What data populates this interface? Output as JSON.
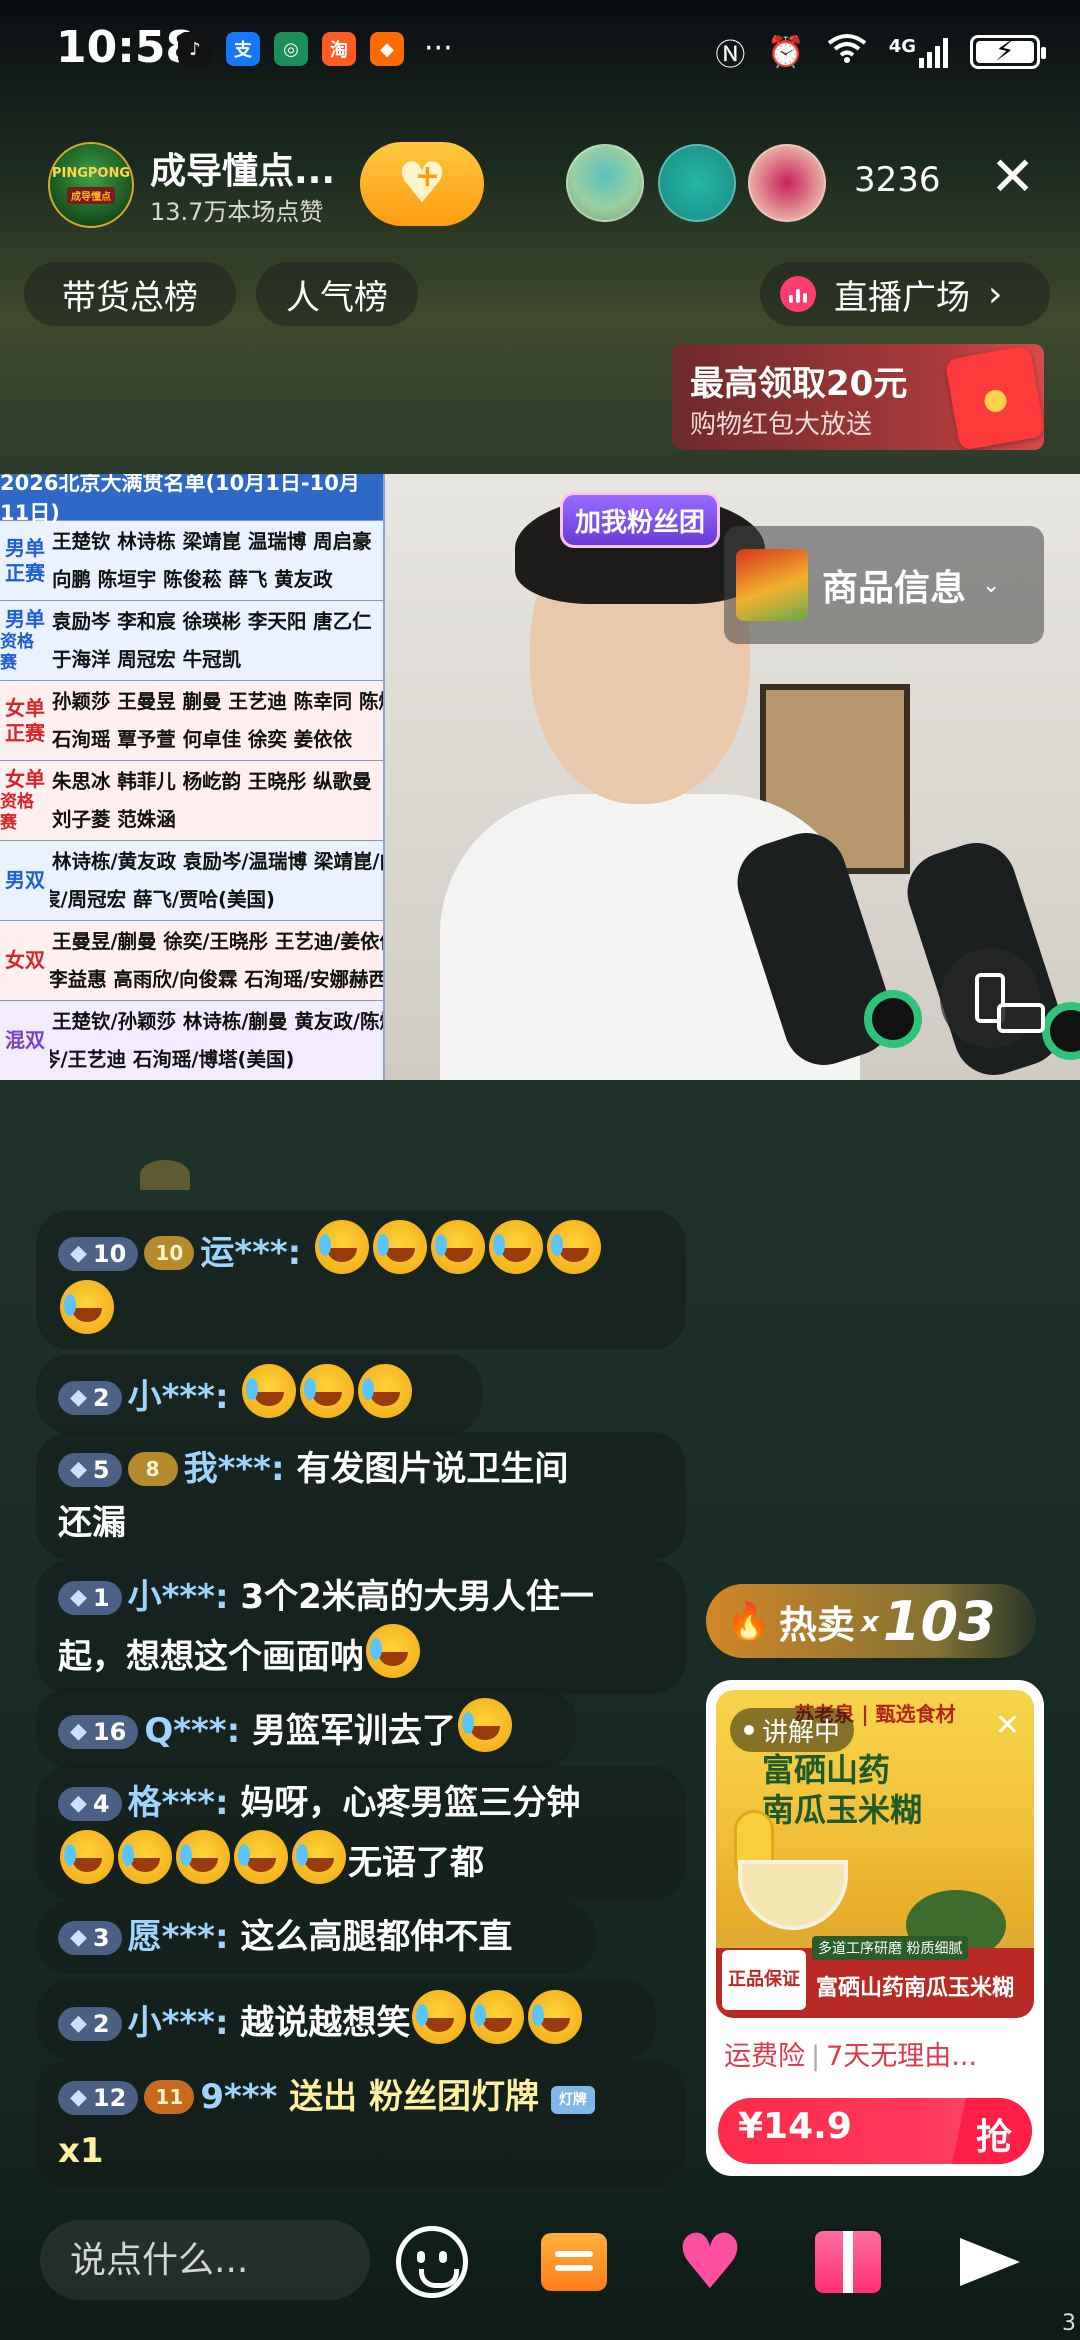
{
  "status_bar": {
    "time": "10:58",
    "apps": [
      {
        "icon": "tiktok-icon",
        "glyph": "♪",
        "color": "#111111"
      },
      {
        "icon": "alipay-icon",
        "glyph": "支",
        "color": "#1677ff"
      },
      {
        "icon": "bank-icon",
        "glyph": "◎",
        "color": "#1b8f5a"
      },
      {
        "icon": "taobao-icon",
        "glyph": "淘",
        "color": "#ff5a1f"
      },
      {
        "icon": "shop-icon",
        "glyph": "◆",
        "color": "#ff6a00"
      }
    ],
    "more": "···",
    "network": "4G"
  },
  "header": {
    "host_name": "成导懂点...",
    "host_likes": "13.7万本场点赞",
    "avatar_text": "PINGPONG",
    "avatar_sub": "成导懂点",
    "viewer_count": "3236"
  },
  "chips": {
    "sales_rank": "带货总榜",
    "popularity_rank": "人气榜",
    "live_plaza": "直播广场"
  },
  "red_packet": {
    "title": "最高领取20元",
    "subtitle": "购物红包大放送"
  },
  "video": {
    "fan_badge": "加我粉丝团",
    "product_info": "商品信息"
  },
  "schedule": {
    "title": "2026北京大满贯名单(10月1日-10月11日)",
    "rows": [
      {
        "cat1": "男单",
        "cat2": "正赛",
        "color": "#1f5fd1",
        "bg": "#eaf2ff",
        "line1": "王楚钦 林诗栋 梁靖崑 温瑞博 周启豪",
        "line2": "向鹏 陈垣宇 陈俊菘 薛飞 黄友政"
      },
      {
        "cat1": "男单",
        "cat2": "资格赛",
        "color": "#1f5fd1",
        "bg": "#eaf2ff",
        "line1": "袁励岑 李和宸 徐瑛彬 李天阳 唐乙仁",
        "line2": "于海洋 周冠宏 牛冠凯"
      },
      {
        "cat1": "女单",
        "cat2": "正赛",
        "color": "#d6262b",
        "bg": "#fff0ef",
        "line1": "孙颖莎 王曼昱 蒯曼 王艺迪 陈幸同 陈熠",
        "line2": "石洵瑶 覃予萱 何卓佳 徐奕 姜依依"
      },
      {
        "cat1": "女单",
        "cat2": "资格赛",
        "color": "#d6262b",
        "bg": "#fff0ef",
        "line1": "朱思冰 韩菲儿 杨屹韵 王晓彤 纵歌曼",
        "line2": "刘子菱 范姝涵"
      },
      {
        "cat1": "男双",
        "cat2": "",
        "color": "#1f5fd1",
        "bg": "#eaf2ff",
        "line1": "林诗栋/黄友政 袁励岑/温瑞博 梁靖崑/向鹏",
        "line2": "李和宸/周冠宏 薛飞/贾哈(美国)"
      },
      {
        "cat1": "女双",
        "cat2": "",
        "color": "#d6262b",
        "bg": "#fff0ef",
        "line1": "王曼昱/蒯曼 徐奕/王晓彤 王艺迪/姜依依",
        "line2": "陈熠/李益惠 高雨欣/向俊霖 石洵瑶/安娜赫西(威尔士)"
      },
      {
        "cat1": "混双",
        "cat2": "",
        "color": "#7b3fc4",
        "bg": "#f3ecff",
        "line1": "王楚钦/孙颖莎 林诗栋/蒯曼 黄友政/陈熠",
        "line2": "袁励岑/王艺迪 石洵瑶/博塔(美国)"
      }
    ]
  },
  "comments": [
    {
      "level": "10",
      "fan": "10",
      "fan_color": "gold",
      "user": "运***:",
      "text": "",
      "emojis_inline": 5,
      "emojis_line2": 1
    },
    {
      "level": "2",
      "fan": "",
      "user": "小***:",
      "text": "",
      "emojis_inline": 3
    },
    {
      "level": "5",
      "fan": "8",
      "fan_color": "gold",
      "user": "我***:",
      "text": "有发图片说卫生间",
      "line2": "还漏"
    },
    {
      "level": "1",
      "fan": "",
      "user": "小***:",
      "text": "3个2米高的大男人住一",
      "line2": "起，想想这个画面呐",
      "emojis_line2": 1
    },
    {
      "level": "16",
      "fan": "",
      "user": "Q***:",
      "text": "男篮军训去了",
      "emojis_inline": 1
    },
    {
      "level": "4",
      "fan": "",
      "user": "格***:",
      "text": "妈呀，心疼男篮三分钟",
      "line2": "无语了都",
      "emojis_line2_before": 5
    },
    {
      "level": "3",
      "fan": "",
      "user": "愿***:",
      "text": "这么高腿都伸不直"
    },
    {
      "level": "2",
      "fan": "",
      "user": "小***:",
      "text": "越说越想笑",
      "emojis_inline": 3
    },
    {
      "level": "12",
      "fan": "11",
      "fan_color": "orange",
      "user": "9***",
      "text": "送出 粉丝团灯牌",
      "line2": "x1",
      "gift": true
    }
  ],
  "hot_sale": {
    "label": "热卖",
    "x": "x",
    "count": "103"
  },
  "product_card": {
    "explaining": "讲解中",
    "brand": "苏老泉 | 甄选食材",
    "name_line1": "富硒山药",
    "name_line2": "南瓜玉米糊",
    "guarantee": "正品保证",
    "strip_top": "多道工序研磨 粉质细腻",
    "strip_text": "富硒山药南瓜玉米糊",
    "tag1": "运费险",
    "tag2": "7天无理由...",
    "price": "¥14.9",
    "buy": "抢"
  },
  "bottom_bar": {
    "input_placeholder": "说点什么..."
  },
  "page_number": "3"
}
